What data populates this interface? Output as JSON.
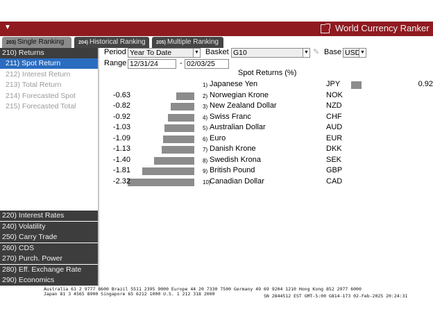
{
  "header": {
    "menu_glyph": "▼",
    "title": "World Currency Ranker"
  },
  "tabs": [
    {
      "num": "203)",
      "label": "Single Ranking",
      "active": true
    },
    {
      "num": "204)",
      "label": "Historical Ranking",
      "active": false
    },
    {
      "num": "205)",
      "label": "Multiple Ranking",
      "active": false
    }
  ],
  "sidebar": {
    "returns_header": "210) Returns",
    "sub_items": [
      {
        "label": "211) Spot Return",
        "selected": true
      },
      {
        "label": "212) Interest Return",
        "selected": false
      },
      {
        "label": "213) Total Return",
        "selected": false
      },
      {
        "label": "214) Forecasted Spot",
        "selected": false
      },
      {
        "label": "215) Forecasted Total",
        "selected": false
      }
    ],
    "categories": [
      "220) Interest Rates",
      "240) Volatility",
      "250) Carry Trade",
      "260) CDS",
      "270) Purch. Power",
      "280) Eff. Exchange Rate",
      "290) Economics"
    ]
  },
  "controls": {
    "period_label": "Period",
    "period_value": "Year To Date",
    "basket_label": "Basket",
    "basket_value": "G10",
    "base_label": "Base",
    "base_value": "USD",
    "range_label": "Range",
    "range_start": "12/31/24",
    "range_sep": "-",
    "range_end": "02/03/25"
  },
  "table": {
    "column_title": "Spot Returns (%)",
    "rows": [
      {
        "rank": "1)",
        "name": "Japanese Yen",
        "code": "JPY",
        "value": "0.92",
        "num": 0.92
      },
      {
        "rank": "2)",
        "name": "Norwegian Krone",
        "code": "NOK",
        "value": "-0.63",
        "num": -0.63
      },
      {
        "rank": "3)",
        "name": "New Zealand Dollar",
        "code": "NZD",
        "value": "-0.82",
        "num": -0.82
      },
      {
        "rank": "4)",
        "name": "Swiss Franc",
        "code": "CHF",
        "value": "-0.92",
        "num": -0.92
      },
      {
        "rank": "5)",
        "name": "Australian Dollar",
        "code": "AUD",
        "value": "-1.03",
        "num": -1.03
      },
      {
        "rank": "6)",
        "name": "Euro",
        "code": "EUR",
        "value": "-1.09",
        "num": -1.09
      },
      {
        "rank": "7)",
        "name": "Danish Krone",
        "code": "DKK",
        "value": "-1.13",
        "num": -1.13
      },
      {
        "rank": "8)",
        "name": "Swedish Krona",
        "code": "SEK",
        "value": "-1.40",
        "num": -1.4
      },
      {
        "rank": "9)",
        "name": "British Pound",
        "code": "GBP",
        "value": "-1.81",
        "num": -1.81
      },
      {
        "rank": "10)",
        "name": "Canadian Dollar",
        "code": "CAD",
        "value": "-2.32",
        "num": -2.32
      }
    ]
  },
  "ticker": {
    "line1": "Australia 61 2 9777 8600  Brazil 5511 2395 9000  Europe 44 20 7330 7500  Germany 49 69 9204 1210  Hong Kong 852 2977 6000",
    "line2a": "Japan 81 3 4565 8900        Singapore 65 6212 1000       U.S. 1 212 318 2000",
    "line2b": "SN 2844512 EST  GMT-5:00 G814-173 02-Feb-2025 20:24:31"
  },
  "colors": {
    "title_bar": "#8f1a20",
    "selected": "#2a6cc0",
    "bar": "#8c8c8c"
  }
}
